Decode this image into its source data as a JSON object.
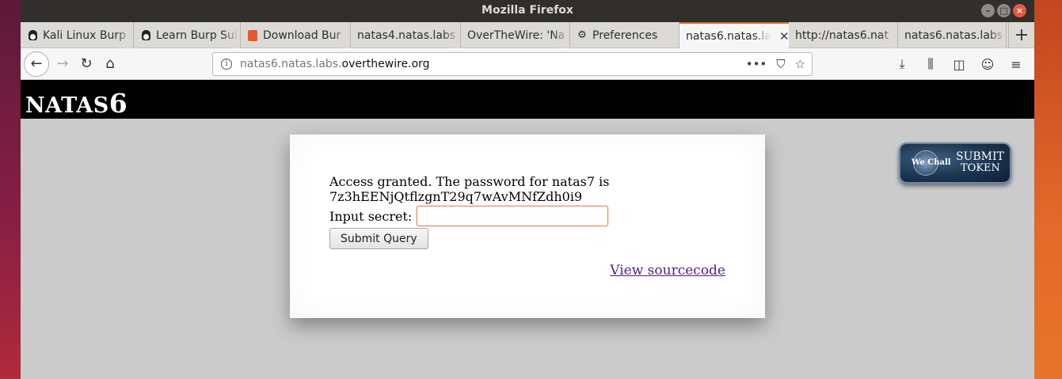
{
  "window": {
    "title": "Mozilla Firefox",
    "controls": [
      "–",
      "□",
      "×"
    ]
  },
  "tabs": [
    {
      "label": "Kali Linux Burp",
      "icon": "tux-icon",
      "active": false
    },
    {
      "label": "Learn Burp Sui",
      "icon": "tux-icon",
      "active": false
    },
    {
      "label": "Download Bur",
      "icon": "burp-icon",
      "active": false
    },
    {
      "label": "natas4.natas.labs",
      "icon": "",
      "active": false
    },
    {
      "label": "OverTheWire: 'Na",
      "icon": "",
      "active": false
    },
    {
      "label": "Preferences",
      "icon": "gear-icon",
      "active": false
    },
    {
      "label": "natas6.natas.la",
      "icon": "",
      "active": true
    },
    {
      "label": "http://natas6.nat",
      "icon": "",
      "active": false
    },
    {
      "label": "natas6.natas.labs",
      "icon": "",
      "active": false
    }
  ],
  "new_tab_label": "+",
  "nav": {
    "back": "←",
    "forward": "→",
    "reload": "↻",
    "home": "⌂"
  },
  "url": {
    "host_prefix": "natas6.natas.labs.",
    "domain": "overthewire.org",
    "actions": [
      "•••",
      "⛉",
      "☆"
    ]
  },
  "toolbar_icons": [
    "⤓",
    "⫼",
    "◫",
    "☺",
    "≡"
  ],
  "site": {
    "title_prefix": "NATAS",
    "title_number": "6"
  },
  "card": {
    "message_line1": "Access granted. The password for natas7 is",
    "message_line2": "7z3hEENjQtflzgnT29q7wAvMNfZdh0i9",
    "input_label": "Input secret:",
    "input_value": "",
    "submit_label": "Submit Query",
    "source_link": "View sourcecode"
  },
  "token_button": {
    "brand": "We Chall",
    "line1": "SUBMIT",
    "line2": "TOKEN"
  },
  "colors": {
    "accent_tab": "#e86a2a",
    "header_bg": "#000000",
    "link": "#551a8b"
  }
}
